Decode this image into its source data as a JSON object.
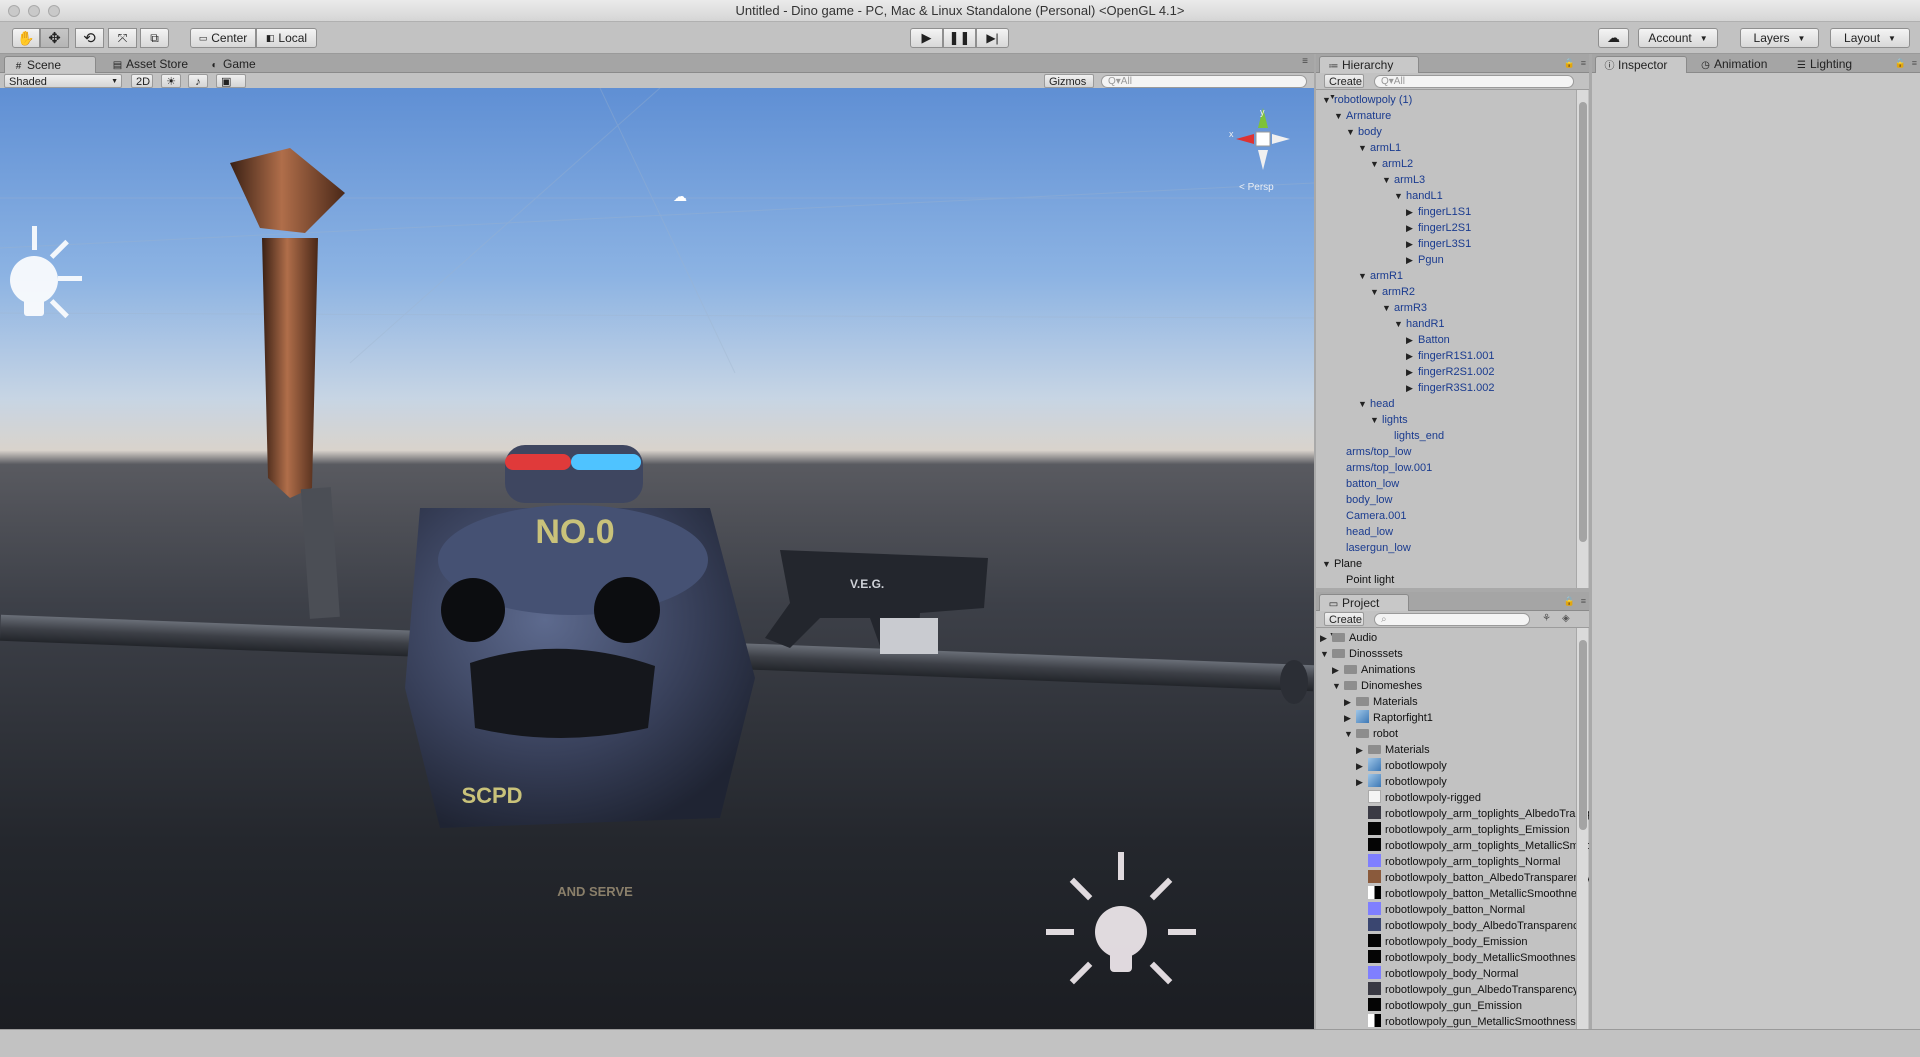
{
  "window": {
    "title": "Untitled - Dino game - PC, Mac & Linux Standalone (Personal) <OpenGL 4.1>"
  },
  "toolbar": {
    "pivot_label": "Center",
    "space_label": "Local",
    "account_label": "Account",
    "layers_label": "Layers",
    "layout_label": "Layout"
  },
  "scene_panel": {
    "tabs": [
      "Scene",
      "Asset Store",
      "Game"
    ],
    "shading_mode": "Shaded",
    "mode_2d": "2D",
    "gizmos_label": "Gizmos",
    "search_placeholder": "Q▾All",
    "projection_label": "< Persp",
    "gizmo_axis_x": "x",
    "gizmo_axis_y": "y",
    "robot_decals": {
      "hat_text": "NO.0",
      "badge_text": "SCPD",
      "motto": "AND SERVE",
      "gun_text": "V.E.G."
    }
  },
  "hierarchy": {
    "tab_label": "Hierarchy",
    "create_label": "Create",
    "search_placeholder": "Q▾All",
    "items": [
      {
        "label": "robotlowpoly (1)",
        "depth": 0,
        "toggle": "open",
        "color": "blue"
      },
      {
        "label": "Armature",
        "depth": 1,
        "toggle": "open",
        "color": "blue"
      },
      {
        "label": "body",
        "depth": 2,
        "toggle": "open",
        "color": "blue"
      },
      {
        "label": "armL1",
        "depth": 3,
        "toggle": "open",
        "color": "blue"
      },
      {
        "label": "armL2",
        "depth": 4,
        "toggle": "open",
        "color": "blue"
      },
      {
        "label": "armL3",
        "depth": 5,
        "toggle": "open",
        "color": "blue"
      },
      {
        "label": "handL1",
        "depth": 6,
        "toggle": "open",
        "color": "blue"
      },
      {
        "label": "fingerL1S1",
        "depth": 7,
        "toggle": "closed",
        "color": "blue"
      },
      {
        "label": "fingerL2S1",
        "depth": 7,
        "toggle": "closed",
        "color": "blue"
      },
      {
        "label": "fingerL3S1",
        "depth": 7,
        "toggle": "closed",
        "color": "blue"
      },
      {
        "label": "Pgun",
        "depth": 7,
        "toggle": "closed",
        "color": "blue"
      },
      {
        "label": "armR1",
        "depth": 3,
        "toggle": "open",
        "color": "blue"
      },
      {
        "label": "armR2",
        "depth": 4,
        "toggle": "open",
        "color": "blue"
      },
      {
        "label": "armR3",
        "depth": 5,
        "toggle": "open",
        "color": "blue"
      },
      {
        "label": "handR1",
        "depth": 6,
        "toggle": "open",
        "color": "blue"
      },
      {
        "label": "Batton",
        "depth": 7,
        "toggle": "closed",
        "color": "blue"
      },
      {
        "label": "fingerR1S1.001",
        "depth": 7,
        "toggle": "closed",
        "color": "blue"
      },
      {
        "label": "fingerR2S1.002",
        "depth": 7,
        "toggle": "closed",
        "color": "blue"
      },
      {
        "label": "fingerR3S1.002",
        "depth": 7,
        "toggle": "closed",
        "color": "blue"
      },
      {
        "label": "head",
        "depth": 3,
        "toggle": "open",
        "color": "blue"
      },
      {
        "label": "lights",
        "depth": 4,
        "toggle": "open",
        "color": "blue"
      },
      {
        "label": "lights_end",
        "depth": 5,
        "toggle": "none",
        "color": "blue"
      },
      {
        "label": "arms/top_low",
        "depth": 1,
        "toggle": "none",
        "color": "blue"
      },
      {
        "label": "arms/top_low.001",
        "depth": 1,
        "toggle": "none",
        "color": "blue"
      },
      {
        "label": "batton_low",
        "depth": 1,
        "toggle": "none",
        "color": "blue"
      },
      {
        "label": "body_low",
        "depth": 1,
        "toggle": "none",
        "color": "blue"
      },
      {
        "label": "Camera.001",
        "depth": 1,
        "toggle": "none",
        "color": "blue"
      },
      {
        "label": "head_low",
        "depth": 1,
        "toggle": "none",
        "color": "blue"
      },
      {
        "label": "lasergun_low",
        "depth": 1,
        "toggle": "none",
        "color": "blue"
      },
      {
        "label": "Plane",
        "depth": 0,
        "toggle": "open",
        "color": "black"
      },
      {
        "label": "Point light",
        "depth": 1,
        "toggle": "none",
        "color": "black"
      }
    ]
  },
  "project": {
    "tab_label": "Project",
    "create_label": "Create",
    "items": [
      {
        "label": "Audio",
        "depth": 0,
        "toggle": "closed",
        "icon": "folder"
      },
      {
        "label": "Dinosssets",
        "depth": 0,
        "toggle": "open",
        "icon": "folder"
      },
      {
        "label": "Animations",
        "depth": 1,
        "toggle": "closed",
        "icon": "folder"
      },
      {
        "label": "Dinomeshes",
        "depth": 1,
        "toggle": "open",
        "icon": "folder"
      },
      {
        "label": "Materials",
        "depth": 2,
        "toggle": "closed",
        "icon": "folder"
      },
      {
        "label": "Raptorfight1",
        "depth": 2,
        "toggle": "closed",
        "icon": "prefab"
      },
      {
        "label": "robot",
        "depth": 2,
        "toggle": "open",
        "icon": "folder"
      },
      {
        "label": "Materials",
        "depth": 3,
        "toggle": "closed",
        "icon": "folder"
      },
      {
        "label": "robotlowpoly",
        "depth": 3,
        "toggle": "closed",
        "icon": "prefab"
      },
      {
        "label": "robotlowpoly",
        "depth": 3,
        "toggle": "closed",
        "icon": "prefab"
      },
      {
        "label": "robotlowpoly-rigged",
        "depth": 3,
        "toggle": "none",
        "icon": "file"
      },
      {
        "label": "robotlowpoly_arm_toplights_AlbedoTransparency",
        "depth": 3,
        "toggle": "none",
        "icon": "tex-dark"
      },
      {
        "label": "robotlowpoly_arm_toplights_Emission",
        "depth": 3,
        "toggle": "none",
        "icon": "tex-black"
      },
      {
        "label": "robotlowpoly_arm_toplights_MetallicSmoothness",
        "depth": 3,
        "toggle": "none",
        "icon": "tex-black"
      },
      {
        "label": "robotlowpoly_arm_toplights_Normal",
        "depth": 3,
        "toggle": "none",
        "icon": "tex-normal"
      },
      {
        "label": "robotlowpoly_batton_AlbedoTransparency",
        "depth": 3,
        "toggle": "none",
        "icon": "tex-brown"
      },
      {
        "label": "robotlowpoly_batton_MetallicSmoothness",
        "depth": 3,
        "toggle": "none",
        "icon": "tex-bw"
      },
      {
        "label": "robotlowpoly_batton_Normal",
        "depth": 3,
        "toggle": "none",
        "icon": "tex-normal"
      },
      {
        "label": "robotlowpoly_body_AlbedoTransparency",
        "depth": 3,
        "toggle": "none",
        "icon": "tex-blue"
      },
      {
        "label": "robotlowpoly_body_Emission",
        "depth": 3,
        "toggle": "none",
        "icon": "tex-black"
      },
      {
        "label": "robotlowpoly_body_MetallicSmoothness",
        "depth": 3,
        "toggle": "none",
        "icon": "tex-black"
      },
      {
        "label": "robotlowpoly_body_Normal",
        "depth": 3,
        "toggle": "none",
        "icon": "tex-normal"
      },
      {
        "label": "robotlowpoly_gun_AlbedoTransparency",
        "depth": 3,
        "toggle": "none",
        "icon": "tex-dark"
      },
      {
        "label": "robotlowpoly_gun_Emission",
        "depth": 3,
        "toggle": "none",
        "icon": "tex-black"
      },
      {
        "label": "robotlowpoly_gun_MetallicSmoothness",
        "depth": 3,
        "toggle": "none",
        "icon": "tex-bw"
      }
    ]
  },
  "inspector": {
    "tabs": [
      "Inspector",
      "Animation",
      "Lighting"
    ]
  },
  "colors": {
    "hierarchy_link": "#1a3b8f",
    "sky_top": "#5f8fd4",
    "ground": "#24272d",
    "hat_red": "#e03a3a",
    "hat_blue": "#4fc3ff"
  }
}
